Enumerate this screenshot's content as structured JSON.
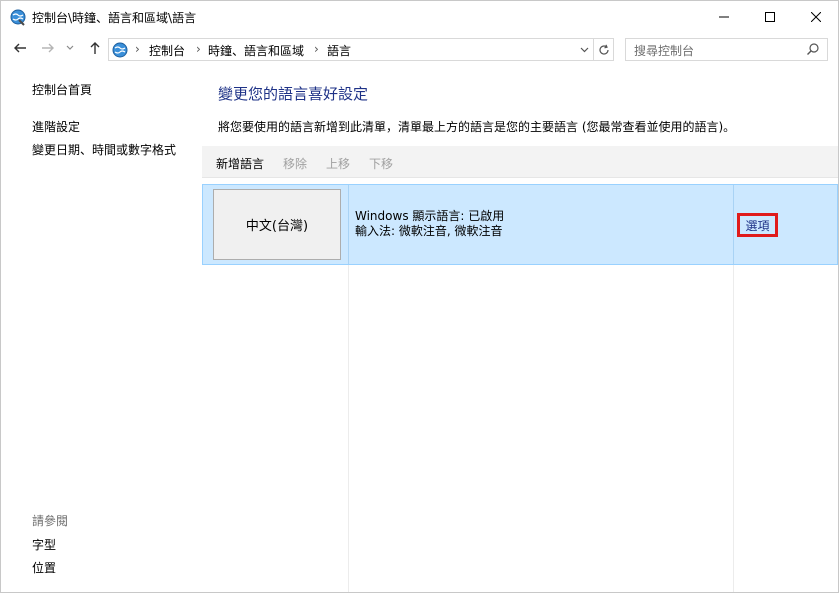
{
  "window": {
    "title": "控制台\\時鐘、語言和區域\\語言"
  },
  "address_bar": {
    "crumbs": [
      "控制台",
      "時鐘、語言和區域",
      "語言"
    ],
    "separator": "›"
  },
  "search": {
    "placeholder": "搜尋控制台"
  },
  "left_pane": {
    "home": "控制台首頁",
    "advanced": "進階設定",
    "change_date": "變更日期、時間或數字格式",
    "see_also_label": "請參閱",
    "fonts": "字型",
    "location": "位置"
  },
  "main": {
    "heading": "變更您的語言喜好設定",
    "description": "將您要使用的語言新增到此清單，清單最上方的語言是您的主要語言 (您最常查看並使用的語言)。",
    "toolbar": {
      "add": "新增語言",
      "remove": "移除",
      "move_up": "上移",
      "move_down": "下移"
    },
    "languages": [
      {
        "name": "中文(台灣)",
        "display_status": "Windows 顯示語言: 已啟用",
        "input_methods": "輸入法: 微軟注音, 微軟注音",
        "options": "選項"
      }
    ]
  },
  "colors": {
    "heading": "#1e3287",
    "selection_bg": "#cce8ff",
    "selection_border": "#99d1ff",
    "highlight_box": "#e01b1b"
  },
  "icons": {
    "window": "control-panel-globe-icon",
    "back": "arrow-left-icon",
    "forward": "arrow-right-icon",
    "recent": "chevron-down-icon",
    "up": "arrow-up-icon",
    "dropdown": "chevron-down-icon",
    "refresh": "refresh-icon",
    "search": "search-icon"
  }
}
